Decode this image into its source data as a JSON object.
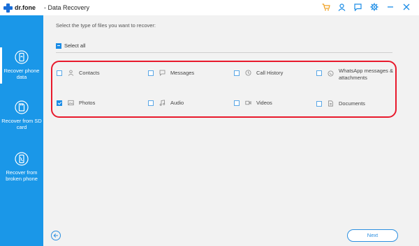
{
  "app": {
    "logo_text": "dr.fone",
    "title": "- Data Recovery"
  },
  "titlebar": {
    "icons": [
      "cart-icon",
      "user-icon",
      "feedback-icon",
      "settings-icon",
      "minimize-icon",
      "close-icon"
    ]
  },
  "sidebar": {
    "items": [
      {
        "label": "Recover phone data",
        "icon": "phone-recover-icon",
        "active": true
      },
      {
        "label": "Recover from SD card",
        "icon": "sd-card-icon",
        "active": false
      },
      {
        "label": "Recover from broken phone",
        "icon": "broken-phone-icon",
        "active": false
      }
    ]
  },
  "main": {
    "prompt": "Select the type of files you want to recover:",
    "select_all": "Select all",
    "file_types": [
      {
        "label": "Contacts",
        "icon": "contacts-icon",
        "checked": false
      },
      {
        "label": "Messages",
        "icon": "messages-icon",
        "checked": false
      },
      {
        "label": "Call History",
        "icon": "call-history-icon",
        "checked": false
      },
      {
        "label": "WhatsApp messages & attachments",
        "icon": "whatsapp-icon",
        "checked": false
      },
      {
        "label": "Photos",
        "icon": "photos-icon",
        "checked": true
      },
      {
        "label": "Audio",
        "icon": "audio-icon",
        "checked": false
      },
      {
        "label": "Videos",
        "icon": "videos-icon",
        "checked": false
      },
      {
        "label": "Documents",
        "icon": "documents-icon",
        "checked": false
      }
    ]
  },
  "footer": {
    "back_icon": "back-arrow-icon",
    "next_label": "Next"
  },
  "colors": {
    "accent": "#1a97e8",
    "highlight_border": "#e8192c",
    "cart": "#f0a020"
  }
}
